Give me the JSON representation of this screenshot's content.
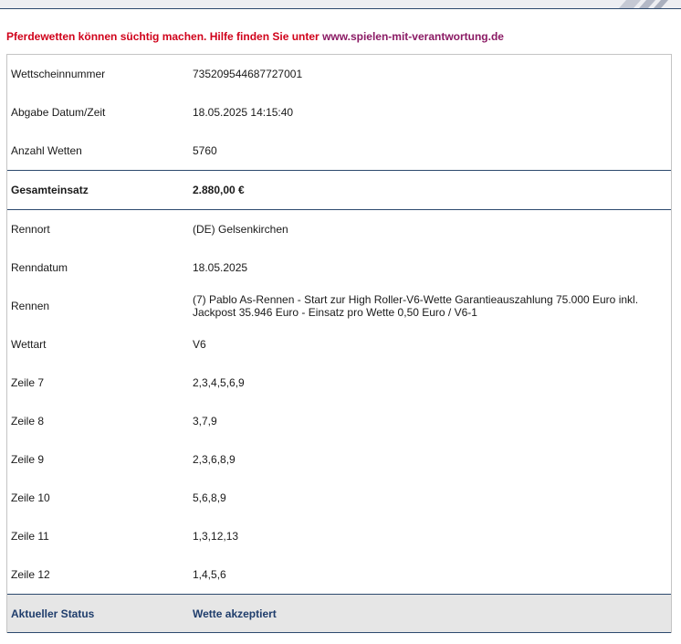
{
  "warning": {
    "text": "Pferdewetten können süchtig machen. Hilfe finden Sie unter ",
    "link": "www.spielen-mit-verantwortung.de"
  },
  "ticket": {
    "rows_top": [
      {
        "label": "Wettscheinnummer",
        "value": "735209544687727001"
      },
      {
        "label": "Abgabe Datum/Zeit",
        "value": "18.05.2025 14:15:40"
      },
      {
        "label": "Anzahl Wetten",
        "value": "5760"
      }
    ],
    "total": {
      "label": "Gesamteinsatz",
      "value": "2.880,00 €"
    },
    "rows_race": [
      {
        "label": "Rennort",
        "value": "(DE) Gelsenkirchen"
      },
      {
        "label": "Renndatum",
        "value": "18.05.2025"
      },
      {
        "label": "Rennen",
        "value": "(7) Pablo As-Rennen - Start zur High Roller-V6-Wette Garantieauszahlung 75.000 Euro inkl. Jackpost 35.946 Euro - Einsatz pro Wette 0,50 Euro / V6-1"
      },
      {
        "label": "Wettart",
        "value": "V6"
      },
      {
        "label": "Zeile 7",
        "value": "2,3,4,5,6,9"
      },
      {
        "label": "Zeile 8",
        "value": "3,7,9"
      },
      {
        "label": "Zeile 9",
        "value": "2,3,6,8,9"
      },
      {
        "label": "Zeile 10",
        "value": "5,6,8,9"
      },
      {
        "label": "Zeile 11",
        "value": "1,3,12,13"
      },
      {
        "label": "Zeile 12",
        "value": "1,4,5,6"
      }
    ],
    "status": {
      "label": "Aktueller Status",
      "value": "Wette akzeptiert"
    }
  },
  "colors": {
    "warning_red": "#d0021b",
    "link_purple": "#8b1a64",
    "navy": "#1f3d6c",
    "status_bg": "#e6e6e6"
  }
}
